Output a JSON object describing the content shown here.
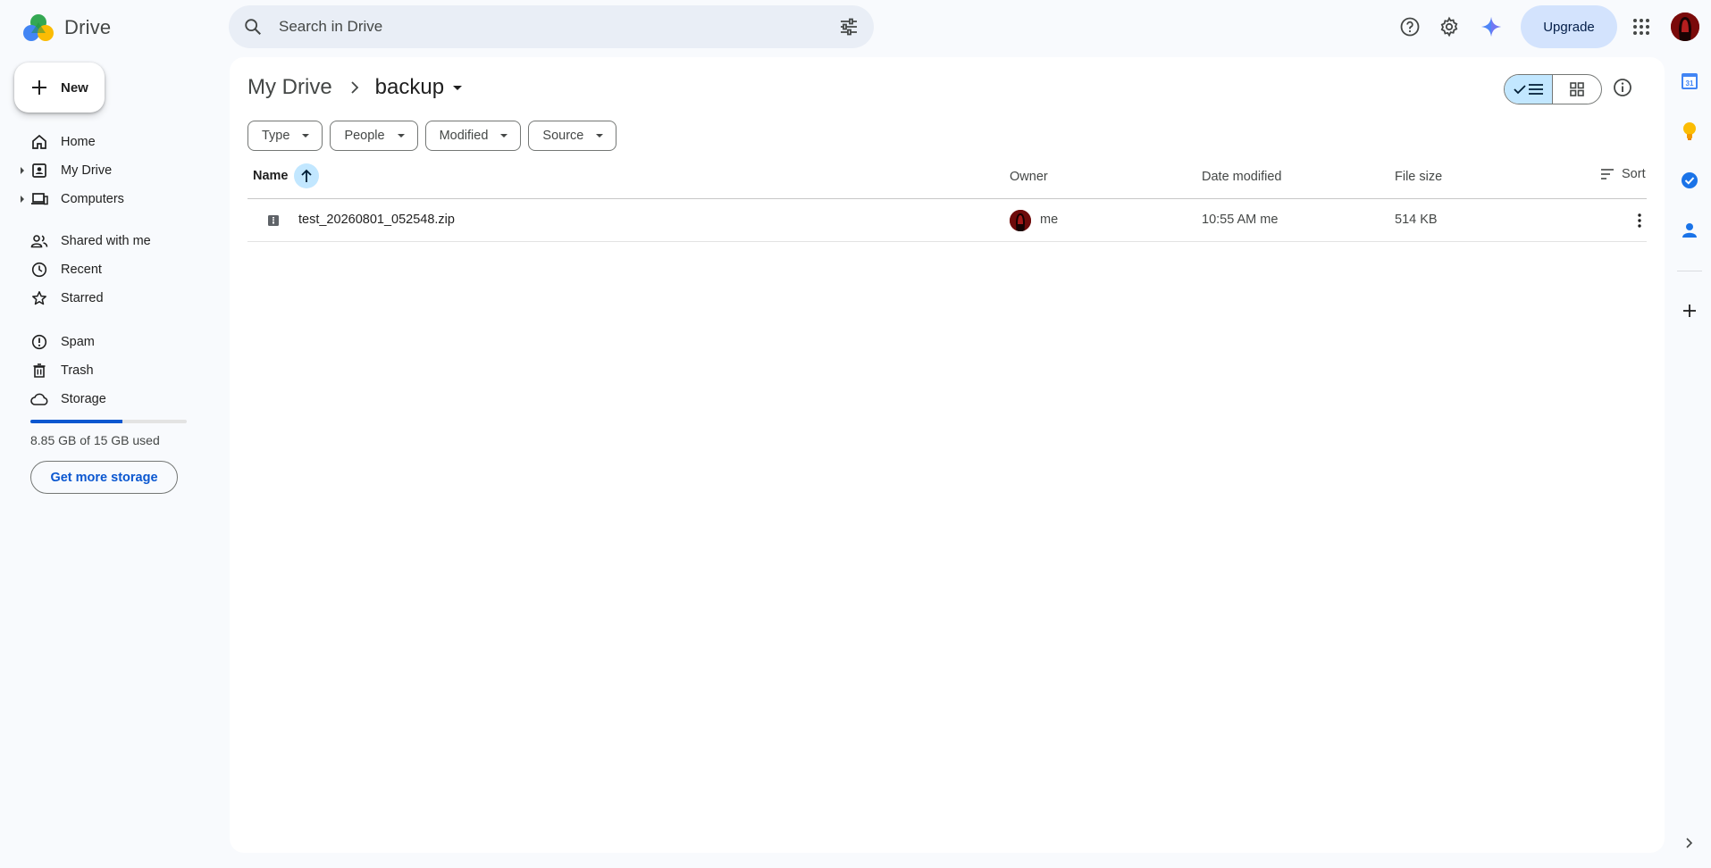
{
  "app": {
    "name": "Drive"
  },
  "search": {
    "placeholder": "Search in Drive"
  },
  "header": {
    "upgrade_label": "Upgrade"
  },
  "sidebar": {
    "new_label": "New",
    "items": [
      {
        "label": "Home",
        "icon": "home-icon"
      },
      {
        "label": "My Drive",
        "icon": "my-drive-icon"
      },
      {
        "label": "Computers",
        "icon": "computers-icon"
      },
      {
        "label": "Shared with me",
        "icon": "shared-icon"
      },
      {
        "label": "Recent",
        "icon": "clock-icon"
      },
      {
        "label": "Starred",
        "icon": "star-icon"
      },
      {
        "label": "Spam",
        "icon": "spam-icon"
      },
      {
        "label": "Trash",
        "icon": "trash-icon"
      },
      {
        "label": "Storage",
        "icon": "cloud-icon"
      }
    ],
    "storage": {
      "text": "8.85 GB of 15 GB used",
      "used_fraction": 0.59,
      "button_label": "Get more storage"
    }
  },
  "main": {
    "breadcrumb": {
      "root": "My Drive",
      "current": "backup"
    },
    "filters": [
      "Type",
      "People",
      "Modified",
      "Source"
    ],
    "columns": {
      "name": "Name",
      "owner": "Owner",
      "date": "Date modified",
      "size": "File size",
      "sort": "Sort"
    },
    "files": [
      {
        "name": "test_20260801_052548.zip",
        "owner": "me",
        "modified": "10:55 AM me",
        "size": "514 KB"
      }
    ]
  },
  "colors": {
    "accent": "#0b57d0",
    "selected": "#c2e7ff",
    "background": "#f8fafd"
  }
}
